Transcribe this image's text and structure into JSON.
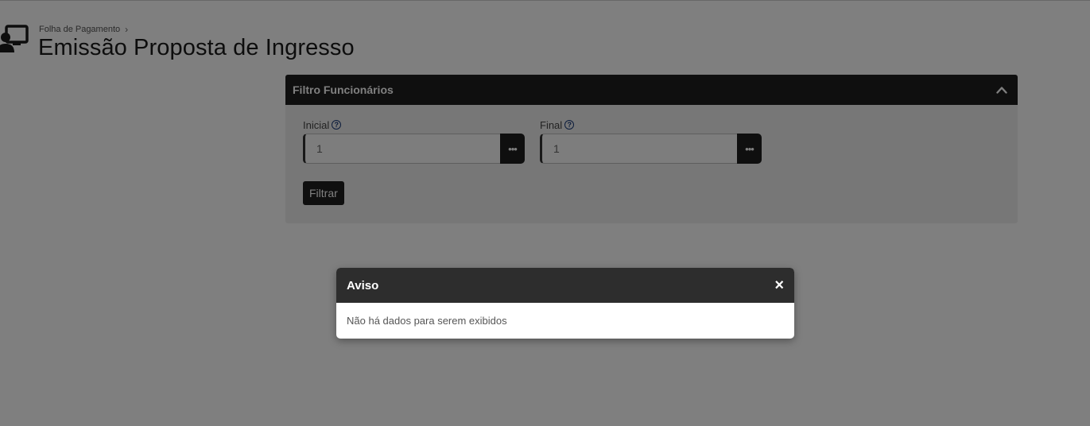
{
  "breadcrumb": {
    "parent": "Folha de Pagamento"
  },
  "page": {
    "title": "Emissão Proposta de Ingresso",
    "icon": "user-screen-icon"
  },
  "filter_panel": {
    "title": "Filtro Funcionários",
    "toggle_icon": "chevron-up-icon",
    "fields": [
      {
        "label": "Inicial",
        "value": "1"
      },
      {
        "label": "Final",
        "value": "1"
      }
    ],
    "search_icon_label": "•••",
    "submit_label": "Filtrar"
  },
  "modal": {
    "title": "Aviso",
    "close_label": "×",
    "message": "Não há dados para serem exibidos"
  },
  "colors": {
    "dark": "#1e1e1e",
    "modal_header": "#2d2d2d",
    "help": "#1a3b7a"
  }
}
